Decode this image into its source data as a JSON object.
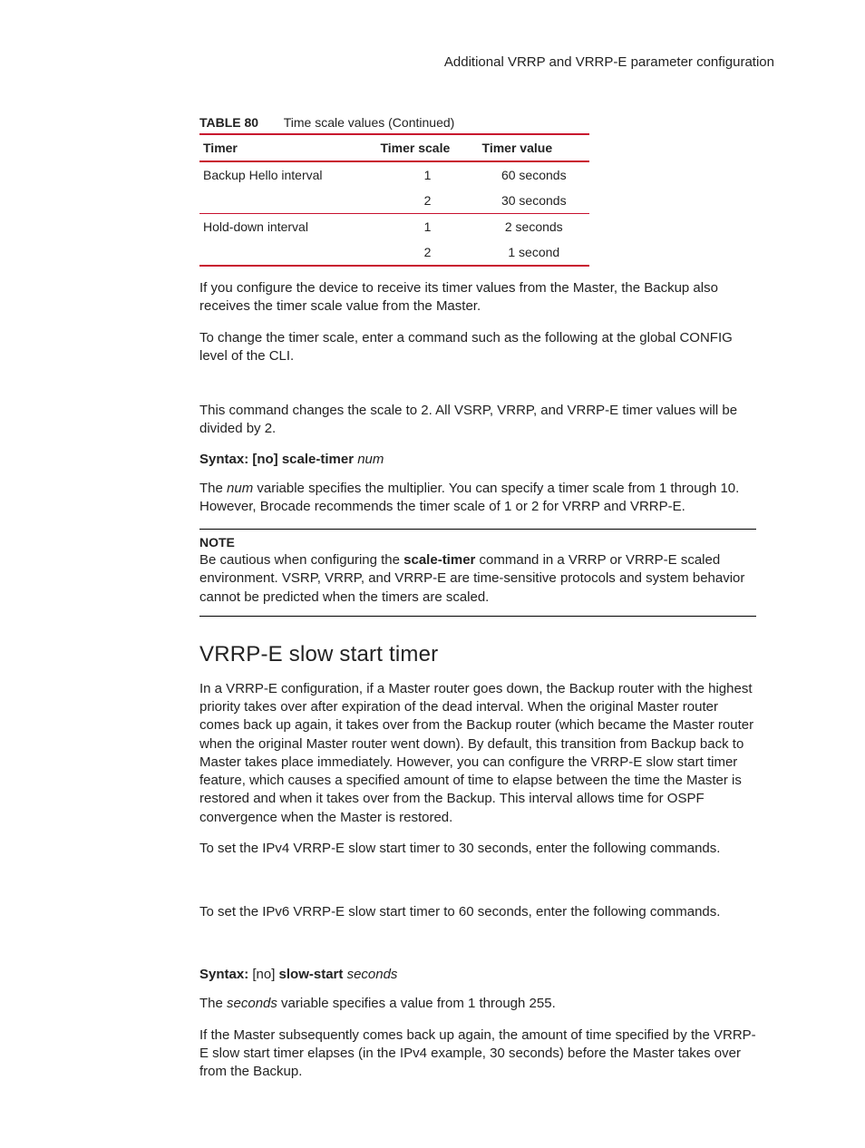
{
  "header": {
    "running_title": "Additional VRRP and VRRP-E parameter configuration"
  },
  "table": {
    "label": "TABLE 80",
    "caption": "Time scale values (Continued)",
    "headers": {
      "c1": "Timer",
      "c2": "Timer scale",
      "c3": "Timer value"
    },
    "rows": [
      {
        "timer": "Backup Hello interval",
        "scale": "1",
        "value": "60 seconds"
      },
      {
        "timer": "",
        "scale": "2",
        "value": "30 seconds"
      },
      {
        "timer": "Hold-down interval",
        "scale": "1",
        "value": "2 seconds"
      },
      {
        "timer": "",
        "scale": "2",
        "value": "1 second"
      }
    ]
  },
  "body": {
    "p1": "If you configure the device to receive its timer values from the Master, the Backup also receives the timer scale value from the Master.",
    "p2": "To change the timer scale, enter a command such as the following at the global CONFIG level of the CLI.",
    "p3": "This command changes the scale to 2.  All VSRP, VRRP, and VRRP-E timer values will be divided by 2.",
    "syntax1_label": "Syntax:  [no] scale-timer ",
    "syntax1_arg": "num",
    "p4a": "The ",
    "p4b": "num",
    "p4c": " variable specifies the multiplier. You can specify a timer scale from 1 through 10. However, Brocade recommends the timer scale of 1 or 2 for VRRP and VRRP-E.",
    "note_label": "NOTE",
    "note_a": "Be cautious when configuring the ",
    "note_cmd": "scale-timer",
    "note_b": " command in a VRRP or VRRP-E scaled environment. VSRP, VRRP, and VRRP-E are time-sensitive protocols and system behavior cannot be predicted when the timers are scaled.",
    "h2": "VRRP-E slow start timer",
    "p5": "In a VRRP-E configuration, if a Master router goes down, the Backup router with the highest priority takes over after expiration of the dead interval. When the original Master router comes back up again, it takes over from the Backup router (which became the Master router when the original Master router went down). By default, this transition from Backup back to Master takes place immediately.  However, you can configure the VRRP-E slow start timer feature, which causes a specified amount of time to elapse between the time the Master is restored and when it takes over from the Backup. This interval allows time for OSPF convergence when the Master is restored.",
    "p6": "To set the IPv4 VRRP-E slow start timer to 30 seconds, enter the following commands.",
    "p7": "To set the IPv6 VRRP-E slow start timer to 60 seconds, enter the following commands.",
    "syntax2_pre": "Syntax:  ",
    "syntax2_no": "[no] ",
    "syntax2_cmd": "slow-start ",
    "syntax2_arg": "seconds",
    "p8a": "The ",
    "p8b": "seconds",
    "p8c": " variable specifies a value from 1 through 255.",
    "p9": "If the Master subsequently comes back up again, the amount of time specified by the VRRP-E slow start timer elapses (in the IPv4 example, 30 seconds) before the Master takes over from the Backup."
  }
}
